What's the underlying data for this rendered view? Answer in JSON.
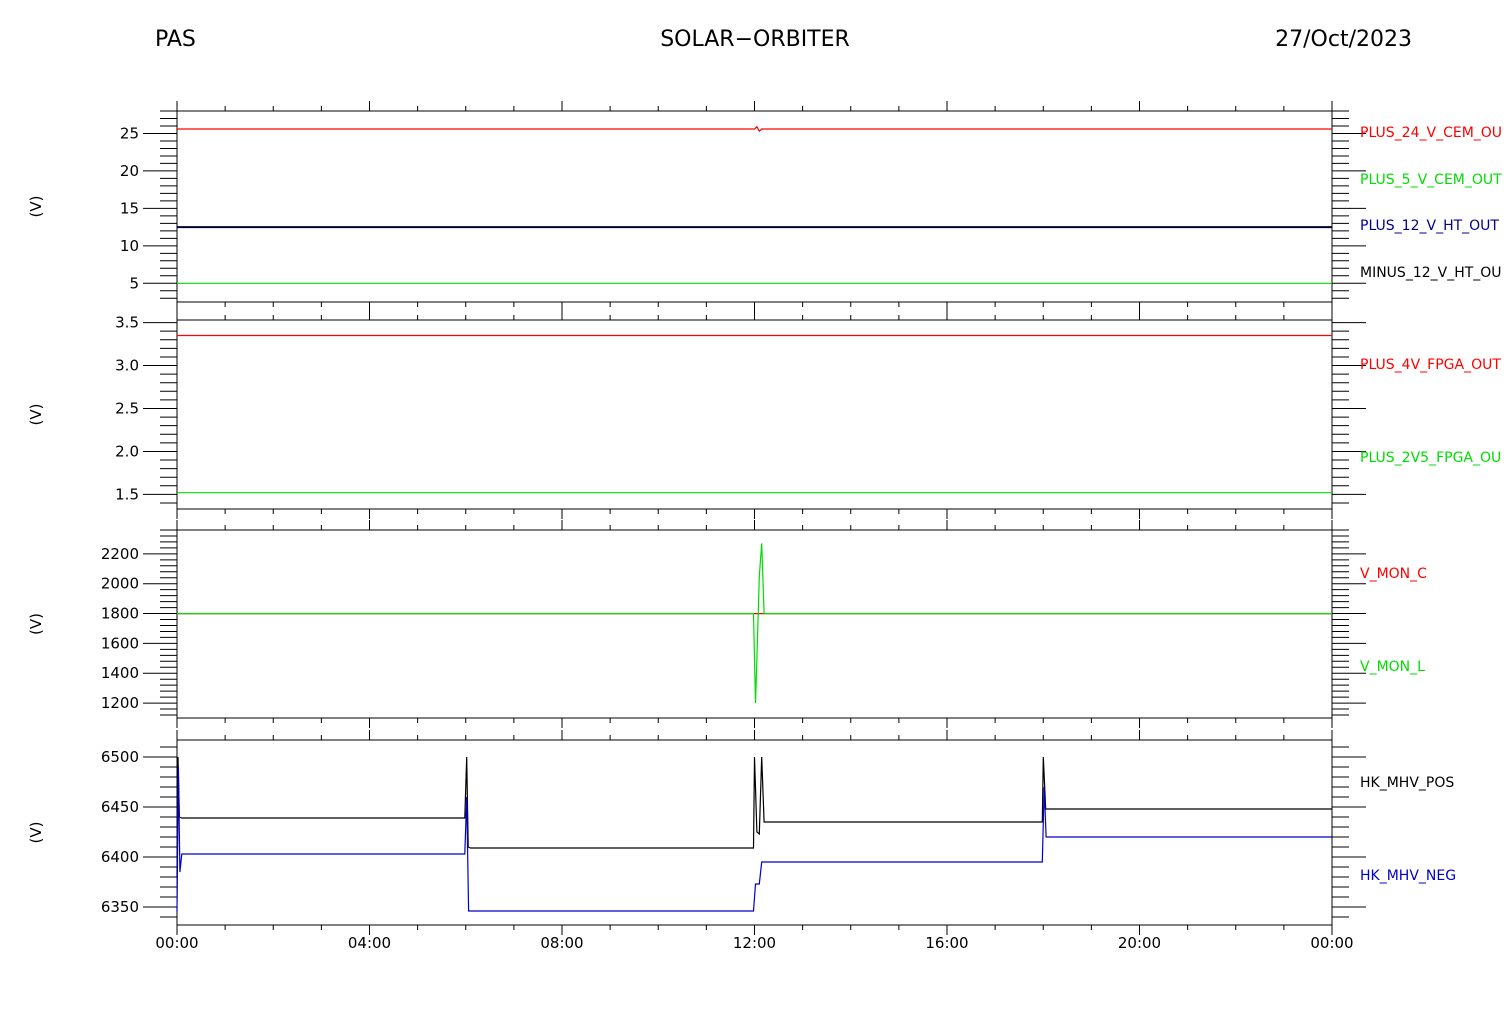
{
  "header": {
    "left": "PAS",
    "center": "SOLAR−ORBITER",
    "right": "27/Oct/2023"
  },
  "chart_data": [
    {
      "type": "line",
      "ylabel": "(V)",
      "ylim": [
        2.5,
        28
      ],
      "yticks": [
        5,
        10,
        15,
        20,
        25
      ],
      "xlim": [
        0,
        24
      ],
      "series": [
        {
          "name": "PLUS_24_V_CEM_OU",
          "color": "#ff0000",
          "x": [
            0,
            12.0,
            12.05,
            12.1,
            12.15,
            12.2,
            24
          ],
          "y": [
            25.6,
            25.6,
            25.9,
            25.3,
            25.6,
            25.6,
            25.6
          ]
        },
        {
          "name": "PLUS_5_V_CEM_OUT",
          "color": "#00dd00",
          "x": [
            0,
            24
          ],
          "y": [
            5.0,
            5.0
          ]
        },
        {
          "name": "PLUS_12_V_HT_OUT",
          "color": "#00008b",
          "x": [
            0,
            24
          ],
          "y": [
            12.5,
            12.5
          ]
        },
        {
          "name": "MINUS_12_V_HT_OU",
          "color": "#000000",
          "x": [
            0,
            24
          ],
          "y": [
            12.5,
            12.5
          ]
        }
      ]
    },
    {
      "type": "line",
      "ylabel": "(V)",
      "ylim": [
        1.33,
        3.53
      ],
      "yticks": [
        1.5,
        2.0,
        2.5,
        3.0,
        3.5
      ],
      "xlim": [
        0,
        24
      ],
      "series": [
        {
          "name": "PLUS_4V_FPGA_OUT",
          "color": "#ff0000",
          "x": [
            0,
            24
          ],
          "y": [
            3.35,
            3.35
          ]
        },
        {
          "name": "PLUS_2V5_FPGA_OU",
          "color": "#00dd00",
          "x": [
            0,
            24
          ],
          "y": [
            1.52,
            1.52
          ]
        }
      ]
    },
    {
      "type": "line",
      "ylabel": "(V)",
      "ylim": [
        1100,
        2360
      ],
      "yticks": [
        1200,
        1400,
        1600,
        1800,
        2000,
        2200
      ],
      "xlim": [
        0,
        24
      ],
      "series": [
        {
          "name": "V_MON_C",
          "color": "#ff0000",
          "x": [
            0,
            24
          ],
          "y": [
            1800,
            1800
          ]
        },
        {
          "name": "V_MON_L",
          "color": "#00dd00",
          "x": [
            0,
            11.98,
            12.02,
            12.05,
            12.1,
            12.15,
            12.2,
            24
          ],
          "y": [
            1800,
            1800,
            1200,
            1500,
            2050,
            2270,
            1800,
            1800
          ]
        }
      ]
    },
    {
      "type": "line",
      "ylabel": "(V)",
      "ylim": [
        6332,
        6517
      ],
      "yticks": [
        6350,
        6400,
        6450,
        6500
      ],
      "xlim": [
        0,
        24
      ],
      "series": [
        {
          "name": "HK_MHV_POS",
          "color": "#000000",
          "x": [
            0,
            0.02,
            0.05,
            0.1,
            5.98,
            6.02,
            6.05,
            6.1,
            11.98,
            12.0,
            12.05,
            12.1,
            12.15,
            12.2,
            17.98,
            18.0,
            18.05,
            18.1,
            24
          ],
          "y": [
            6380,
            6500,
            6440,
            6439,
            6439,
            6500,
            6410,
            6409,
            6409,
            6500,
            6425,
            6423,
            6500,
            6435,
            6435,
            6500,
            6448,
            6448,
            6448
          ]
        },
        {
          "name": "HK_MHV_NEG",
          "color": "#0000cd",
          "x": [
            0,
            0.03,
            0.06,
            0.1,
            5.98,
            6.02,
            6.06,
            6.1,
            11.98,
            12.02,
            12.1,
            12.15,
            12.2,
            17.98,
            18.02,
            18.06,
            18.1,
            24
          ],
          "y": [
            6345,
            6490,
            6385,
            6403,
            6403,
            6460,
            6346,
            6346,
            6346,
            6373,
            6373,
            6395,
            6395,
            6395,
            6470,
            6420,
            6420,
            6420
          ]
        }
      ]
    }
  ],
  "xaxis": {
    "ticks": [
      0,
      4,
      8,
      12,
      16,
      20,
      24
    ],
    "tick_labels": [
      "00:00",
      "04:00",
      "08:00",
      "12:00",
      "16:00",
      "20:00",
      "00:00"
    ]
  },
  "legend_colors": {
    "red": "#ff0000",
    "green": "#00dd00",
    "navy": "#00008b",
    "black": "#000000",
    "blue": "#0000cd"
  }
}
